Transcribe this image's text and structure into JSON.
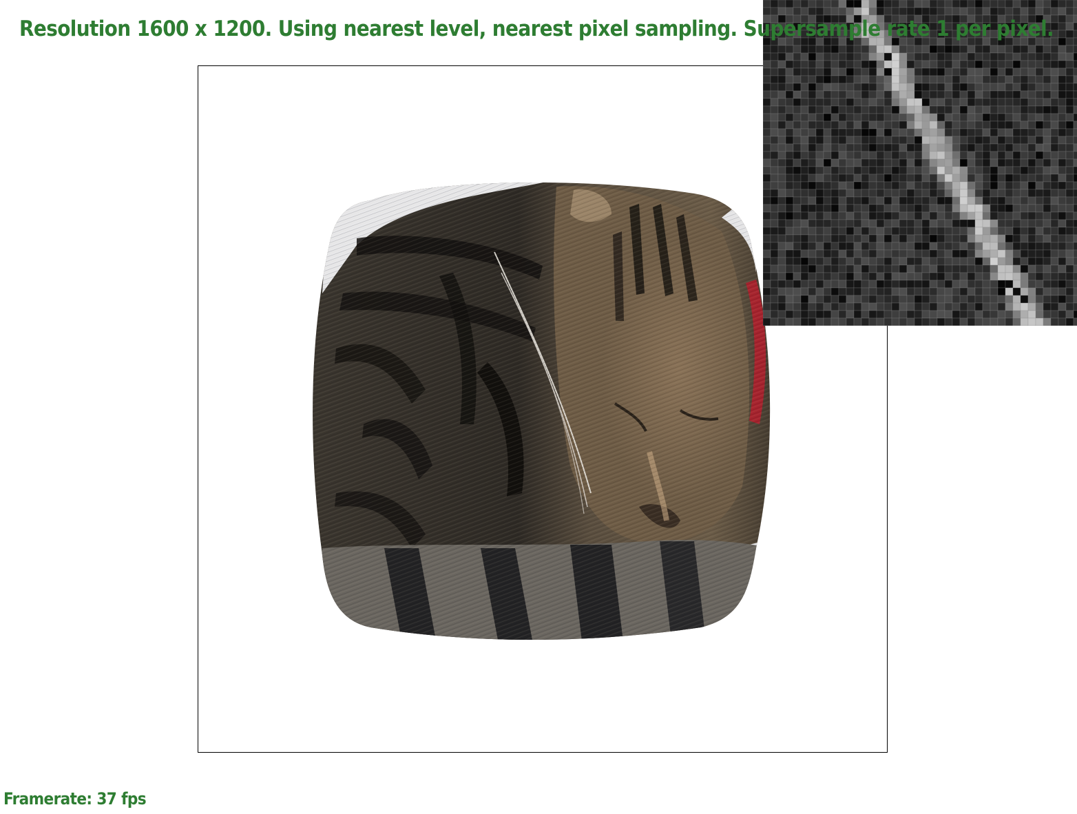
{
  "overlay": {
    "status_text": "Resolution 1600 x 1200. Using nearest level, nearest pixel sampling. Supersample rate 1 per pixel.",
    "framerate_text": "Framerate: 37 fps",
    "text_color": "#2e7d32"
  },
  "scene": {
    "textured_object_icon": "cat-fur-texture",
    "frame_border_color": "#000000"
  },
  "zoom": {
    "icon": "pixel-zoom-magnifier"
  }
}
